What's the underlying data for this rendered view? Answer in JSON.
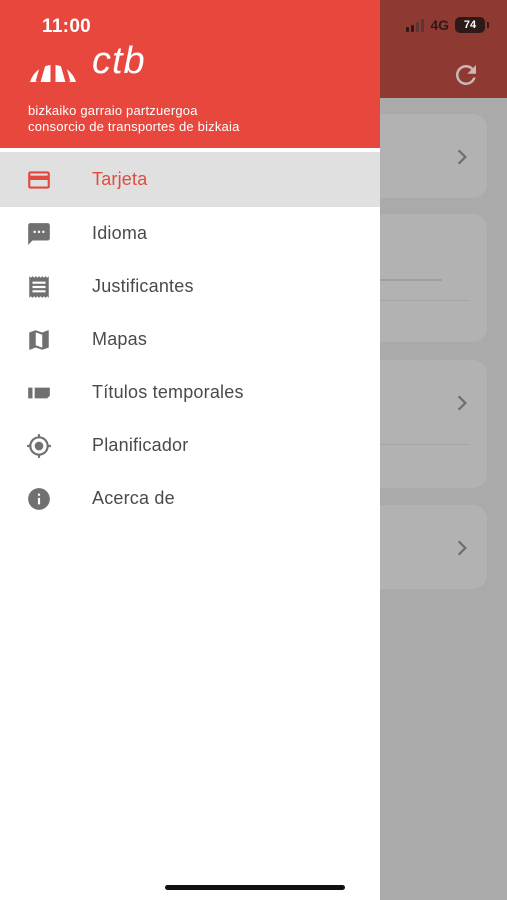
{
  "status_bar": {
    "time": "11:00",
    "network": "4G",
    "battery": "74"
  },
  "brand": {
    "name": "ctb",
    "tagline_line1": "bizkaiko garraio partzuergoa",
    "tagline_line2": "consorcio de transportes de bizkaia",
    "color": "#e8473d"
  },
  "menu": {
    "items": [
      {
        "label": "Tarjeta",
        "icon": "card-icon",
        "active": true
      },
      {
        "label": "Idioma",
        "icon": "chat-icon",
        "active": false
      },
      {
        "label": "Justificantes",
        "icon": "receipt-icon",
        "active": false
      },
      {
        "label": "Mapas",
        "icon": "map-icon",
        "active": false
      },
      {
        "label": "Títulos temporales",
        "icon": "ticket-icon",
        "active": false
      },
      {
        "label": "Planificador",
        "icon": "location-icon",
        "active": false
      },
      {
        "label": "Acerca de",
        "icon": "info-icon",
        "active": false
      }
    ]
  },
  "colors": {
    "accent": "#e24a3f",
    "active_row": "#e0e0e0",
    "icon_gray": "#707070"
  }
}
